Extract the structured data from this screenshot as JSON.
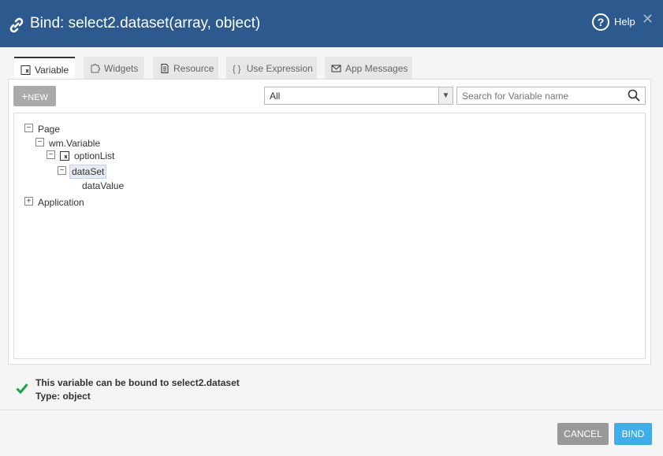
{
  "dialog": {
    "title": "Bind: select2.dataset(array, object)",
    "help_label": "Help",
    "close_glyph": "✕"
  },
  "tabs": [
    {
      "label": "Variable",
      "icon": "variable-icon",
      "active": true
    },
    {
      "label": "Widgets",
      "icon": "puzzle-icon",
      "active": false
    },
    {
      "label": "Resource",
      "icon": "document-icon",
      "active": false
    },
    {
      "label": "Use Expression",
      "icon": "braces-icon",
      "active": false
    },
    {
      "label": "App Messages",
      "icon": "message-icon",
      "active": false
    }
  ],
  "toolbar": {
    "new_label": "NEW",
    "new_glyph": "+",
    "filter_value": "All",
    "search_placeholder": "Search for Variable name"
  },
  "tree": {
    "page": "Page",
    "wm_variable": "wm.Variable",
    "option_list": "optionList",
    "data_set": "dataSet",
    "data_value": "dataValue",
    "application": "Application"
  },
  "status": {
    "message": "This variable can be bound to select2.dataset",
    "type": "Type: object"
  },
  "footer": {
    "cancel_label": "CANCEL",
    "bind_label": "BIND"
  },
  "colors": {
    "header": "#2d5a8e",
    "bind_button": "#3daee9",
    "cancel_button": "#999999",
    "check": "#1aa34a"
  }
}
